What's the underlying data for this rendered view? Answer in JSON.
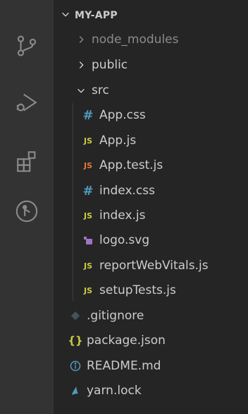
{
  "explorer": {
    "root_label": "MY-APP",
    "items": [
      {
        "label": "node_modules",
        "kind": "folder-collapsed",
        "icon": "chevron-right-icon"
      },
      {
        "label": "public",
        "kind": "folder-collapsed",
        "icon": "chevron-right-icon"
      },
      {
        "label": "src",
        "kind": "folder-expanded",
        "icon": "chevron-down-icon"
      },
      {
        "label": "App.css",
        "kind": "file",
        "icon": "css-hash-icon",
        "glyph": "#"
      },
      {
        "label": "App.js",
        "kind": "file",
        "icon": "js-icon",
        "glyph": "JS"
      },
      {
        "label": "App.test.js",
        "kind": "file",
        "icon": "js-test-icon",
        "glyph": "JS"
      },
      {
        "label": "index.css",
        "kind": "file",
        "icon": "css-hash-icon",
        "glyph": "#"
      },
      {
        "label": "index.js",
        "kind": "file",
        "icon": "js-icon",
        "glyph": "JS"
      },
      {
        "label": "logo.svg",
        "kind": "file",
        "icon": "svg-file-icon"
      },
      {
        "label": "reportWebVitals.js",
        "kind": "file",
        "icon": "js-icon",
        "glyph": "JS"
      },
      {
        "label": "setupTests.js",
        "kind": "file",
        "icon": "js-icon",
        "glyph": "JS"
      },
      {
        "label": ".gitignore",
        "kind": "file",
        "icon": "git-diamond-icon"
      },
      {
        "label": "package.json",
        "kind": "file",
        "icon": "json-braces-icon",
        "glyph": "{}"
      },
      {
        "label": "README.md",
        "kind": "file",
        "icon": "info-circle-icon"
      },
      {
        "label": "yarn.lock",
        "kind": "file",
        "icon": "yarn-icon"
      }
    ]
  },
  "colors": {
    "activity_bar": "#333333",
    "sidebar_bg": "#252526",
    "text": "#cccccc",
    "css_icon": "#519aba",
    "js_icon": "#cbcb41",
    "js_test_icon": "#e37933",
    "svg_icon": "#a074c4",
    "json_icon": "#cbcb41",
    "info_icon": "#519aba",
    "yarn_icon": "#519aba",
    "git_icon": "#41535b"
  },
  "activity_bar": {
    "icons": [
      "source-control-icon",
      "run-debug-icon",
      "extensions-icon",
      "git-graph-icon"
    ]
  }
}
